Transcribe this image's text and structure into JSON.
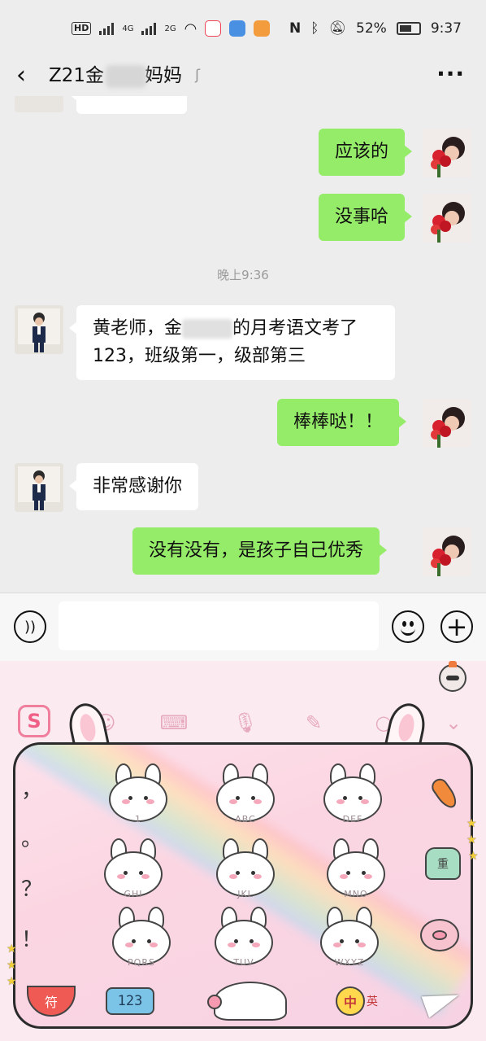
{
  "status_bar": {
    "network_badge": "HD",
    "signal_1": "4G",
    "signal_2": "2G",
    "battery": "52%",
    "time": "9:37"
  },
  "header": {
    "title": "Z21金",
    "title_suffix": "妈妈",
    "more": "···"
  },
  "messages": [
    {
      "side": "out",
      "text": "应该的"
    },
    {
      "side": "out",
      "text": "没事哈"
    },
    {
      "time": "晚上9:36"
    },
    {
      "side": "in",
      "text_prefix": "黄老师，金",
      "text_suffix": "的月考语文考了",
      "text_line2": "123，班级第一，级部第三"
    },
    {
      "side": "out",
      "text": "棒棒哒！！"
    },
    {
      "side": "in",
      "text": "非常感谢你"
    },
    {
      "side": "out",
      "text": "没有没有，是孩子自己优秀"
    }
  ],
  "input_bar": {
    "placeholder": ""
  },
  "keyboard": {
    "punctuation": [
      "，",
      "。",
      "？",
      "！"
    ],
    "keys": [
      "1",
      "ABC",
      "DEF",
      "GHI",
      "JKL",
      "MNO",
      "PQRS",
      "TUV",
      "WXYZ"
    ],
    "cactus_label": "重",
    "fu_label": "符",
    "num_label": "123",
    "lang_label": "中",
    "lang_sub": "英"
  },
  "colors": {
    "outgoing_bubble": "#95ec69",
    "incoming_bubble": "#ffffff",
    "chat_bg": "#ededed",
    "keyboard_bg": "#fbeaf0"
  }
}
